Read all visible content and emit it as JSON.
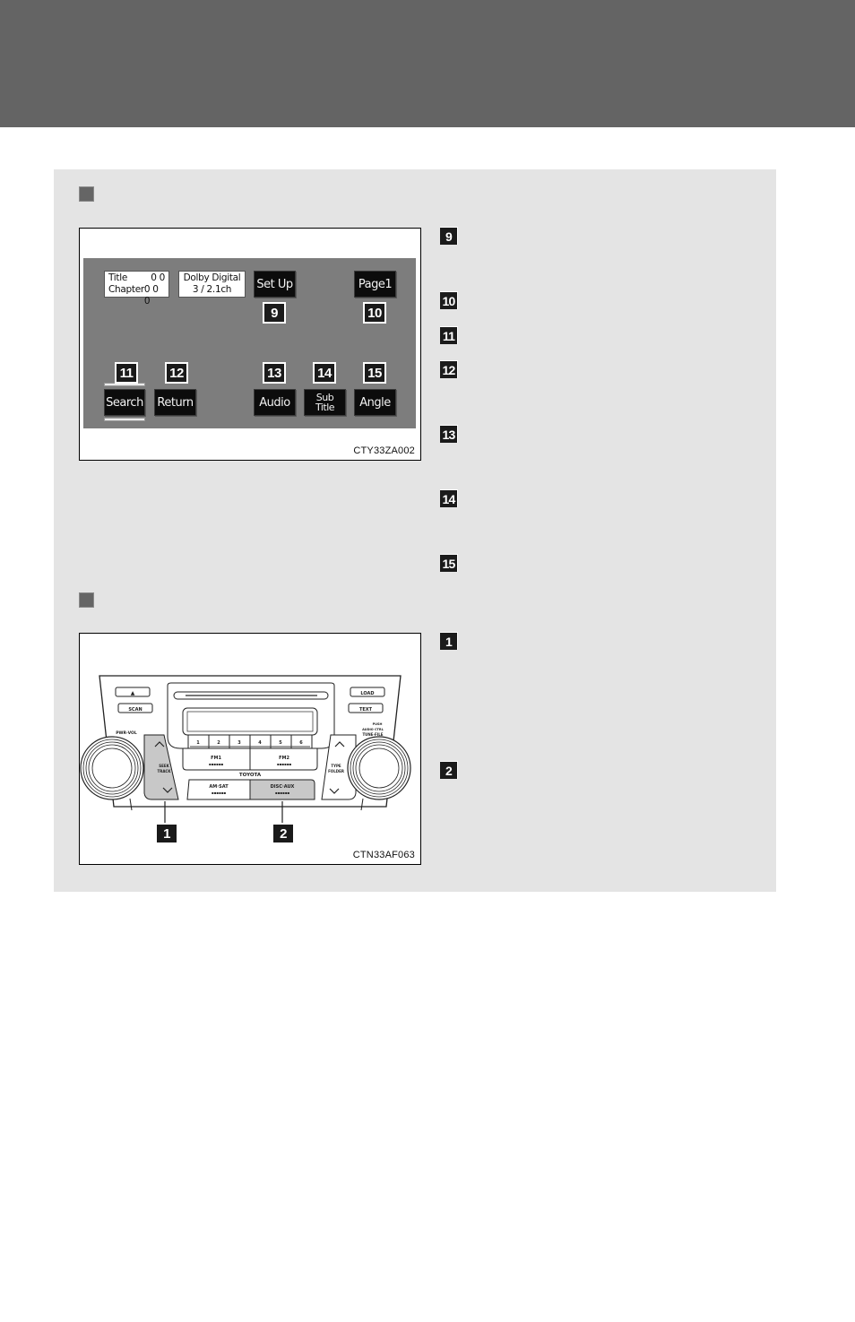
{
  "header": {
    "band_color": "#646464"
  },
  "panel": {
    "background": "#e4e4e4"
  },
  "dvd_figure": {
    "code": "CTY33ZA002",
    "info_box": {
      "title_label": "Title",
      "title_value": "0 0",
      "chapter_label": "Chapter",
      "chapter_value": "0 0 0"
    },
    "audio_format": {
      "line1": "Dolby Digital",
      "line2": "3 / 2.1ch"
    },
    "buttons": {
      "setup": "Set Up",
      "page": "Page1",
      "search": "Search",
      "return": "Return",
      "audio": "Audio",
      "subtitle_line1": "Sub",
      "subtitle_line2": "Title",
      "angle": "Angle"
    },
    "callouts": {
      "setup": "9",
      "page": "10",
      "search": "11",
      "return": "12",
      "audio": "13",
      "subtitle": "14",
      "angle": "15"
    }
  },
  "radio_figure": {
    "code": "CTN33AF063",
    "labels": {
      "eject": "▲",
      "scan": "SCAN",
      "load": "LOAD",
      "text": "TEXT",
      "pwr_vol": "PWR·VOL",
      "push": "PUSH",
      "audio_ctrl": "AUDIO CTRL",
      "tune_file": "TUNE·FILE",
      "seek_track_1": "SEEK",
      "seek_track_2": "TRACK",
      "type_folder_1": "TYPE",
      "type_folder_2": "FOLDER",
      "brand": "TOYOTA",
      "fm1": "FM1",
      "fm2": "FM2",
      "am_sat": "AM·SAT",
      "disc_aux": "DISC·AUX",
      "dots": "▪▪▪▪▪▪"
    },
    "presets": [
      "1",
      "2",
      "3",
      "4",
      "5",
      "6"
    ],
    "callouts": {
      "seek_track": "1",
      "disc_aux": "2"
    }
  },
  "legend_badges": [
    "9",
    "10",
    "11",
    "12",
    "13",
    "14",
    "15",
    "1",
    "2"
  ]
}
